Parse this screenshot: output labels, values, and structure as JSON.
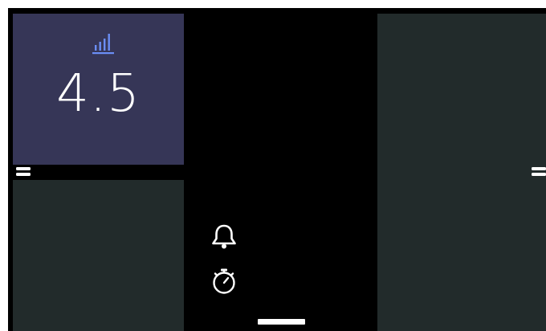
{
  "metric_tile": {
    "icon": "bar-chart-icon",
    "value": "4.5",
    "background": "#363657",
    "icon_color": "#6b8ef5"
  },
  "quick_actions": [
    {
      "icon": "bell-icon"
    },
    {
      "icon": "stopwatch-icon"
    }
  ],
  "panels": {
    "background": "#222b2b"
  },
  "home_indicator": {
    "color": "#ffffff"
  }
}
